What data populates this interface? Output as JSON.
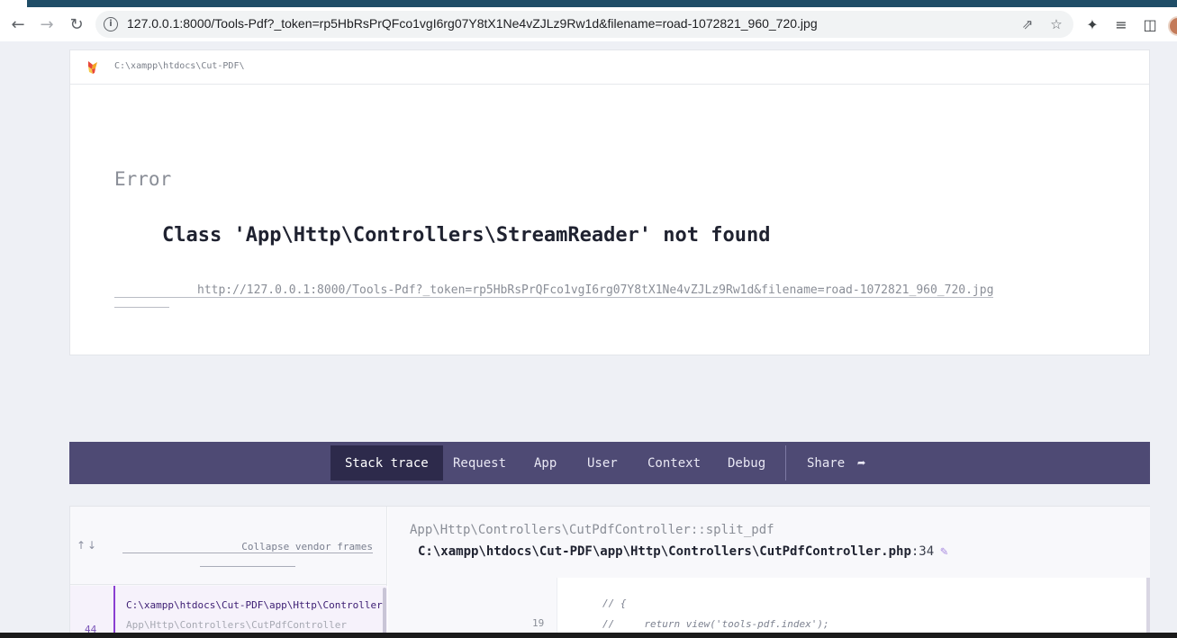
{
  "browser": {
    "url": "127.0.0.1:8000/Tools-Pdf?_token=rp5HbRsPrQFco1vgI6rg07Y8tX1Ne4vZJLz9Rw1d&filename=road-1072821_960_720.jpg",
    "icons": [
      "back-icon",
      "forward-icon",
      "reload-icon",
      "site-info-icon",
      "share-page-icon",
      "bookmark-star-icon",
      "extensions-icon",
      "reading-list-icon",
      "side-panel-icon",
      "profile-avatar"
    ]
  },
  "error_page": {
    "app_path": "C:\\xampp\\htdocs\\Cut-PDF\\",
    "exception_class": "Error",
    "exception_message": "Class 'App\\Http\\Controllers\\StreamReader' not found",
    "request_url": "http://127.0.0.1:8000/Tools-Pdf?_token=rp5HbRsPrQFco1vgI6rg07Y8tX1Ne4vZJLz9Rw1d&filename=road-1072821_960_720.jpg"
  },
  "tabs": {
    "stack_trace": "Stack trace",
    "request": "Request",
    "app": "App",
    "user": "User",
    "context": "Context",
    "debug": "Debug",
    "share": "Share",
    "active": "Stack trace"
  },
  "stack": {
    "collapse_label": "Collapse vendor frames",
    "frames": [
      {
        "number": "44",
        "file": "C:\\xampp\\htdocs\\Cut-PDF\\app\\Http\\Controllers\\CutPdfController.php",
        "class": "App\\Http\\Controllers\\CutPdfController"
      }
    ],
    "selected": {
      "function": "App\\Http\\Controllers\\CutPdfController::split_pdf",
      "file": "C:\\xampp\\htdocs\\Cut-PDF\\app\\Http\\Controllers\\CutPdfController.php",
      "line_suffix": ":34"
    },
    "code": {
      "lines": [
        {
          "number": "",
          "text": "// {"
        },
        {
          "number": "19",
          "text": "//     return view('tools-pdf.index');"
        }
      ]
    }
  },
  "colors": {
    "tabs_bg": "#4e4a74",
    "tab_active_bg": "#2d2a4b",
    "frame_accent": "#8a3fd1",
    "page_bg": "#eef0f5"
  }
}
